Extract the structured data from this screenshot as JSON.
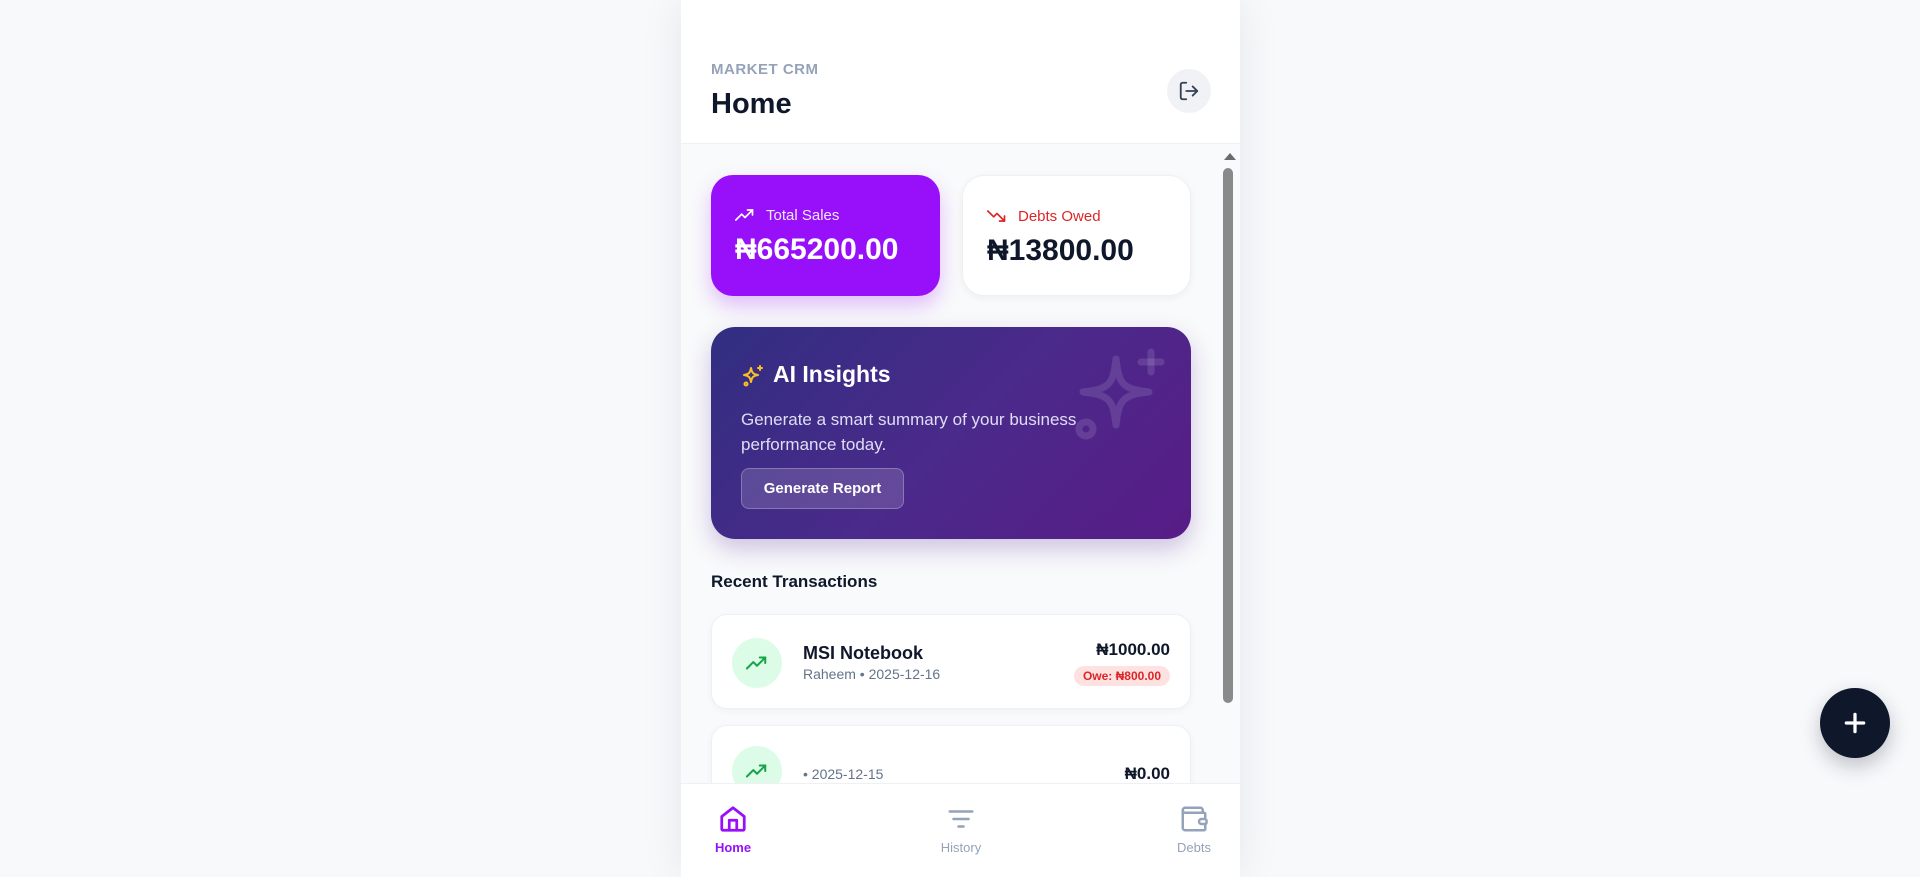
{
  "header": {
    "brand": "MARKET CRM",
    "title": "Home"
  },
  "summary": {
    "total_sales_label": "Total Sales",
    "total_sales_value": "₦665200.00",
    "debts_label": "Debts Owed",
    "debts_value": "₦13800.00"
  },
  "ai_insights": {
    "title": "AI Insights",
    "description": "Generate a smart summary of your business performance today.",
    "button_label": "Generate Report"
  },
  "recent": {
    "title": "Recent Transactions",
    "items": [
      {
        "name": "MSI Notebook",
        "meta": "Raheem • 2025-12-16",
        "amount": "₦1000.00",
        "owe": "Owe: ₦800.00"
      },
      {
        "name": "",
        "meta": "• 2025-12-15",
        "amount": "₦0.00"
      }
    ]
  },
  "nav": {
    "home": "Home",
    "history": "History",
    "debts": "Debts"
  },
  "fab": {
    "label": "+"
  },
  "colors": {
    "accent": "#9810fa",
    "danger": "#dc2626",
    "success": "#16a34a",
    "dark": "#0f172a"
  },
  "icons": {
    "logout": "logout-icon",
    "sales": "trending-up-icon",
    "debts": "trending-down-icon",
    "ai": "sparkles-icon",
    "home": "home-icon",
    "history": "filter-lines-icon",
    "debts_nav": "wallet-icon",
    "fab": "plus-icon"
  }
}
